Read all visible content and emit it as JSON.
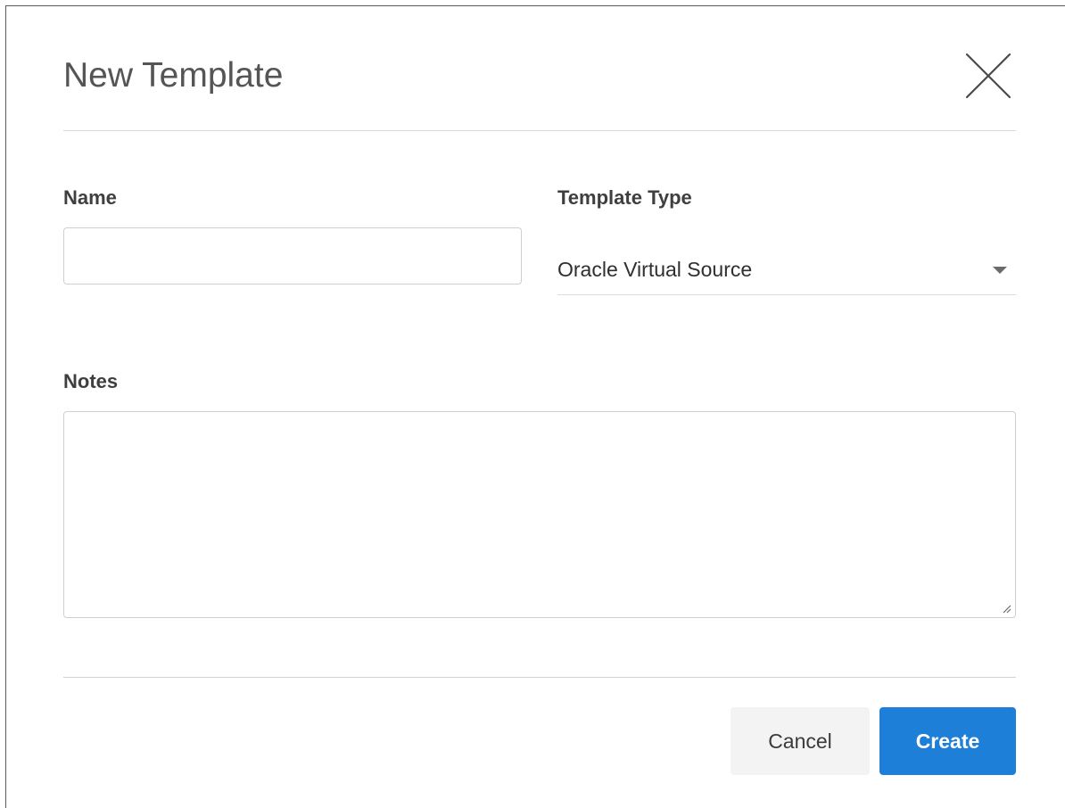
{
  "dialog": {
    "title": "New Template",
    "close_icon": "close-icon"
  },
  "form": {
    "name_label": "Name",
    "name_value": "",
    "name_placeholder": "",
    "type_label": "Template Type",
    "type_value": "Oracle Virtual Source",
    "notes_label": "Notes",
    "notes_value": ""
  },
  "footer": {
    "cancel_label": "Cancel",
    "create_label": "Create"
  },
  "colors": {
    "primary": "#1e7fd9",
    "cancel_bg": "#f3f3f3",
    "title_text": "#555555",
    "divider": "#d8d8d8"
  }
}
